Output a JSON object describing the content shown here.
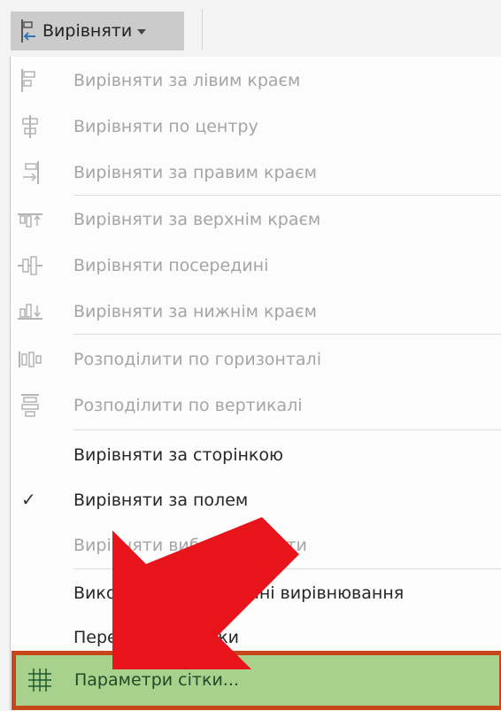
{
  "toolbar": {
    "align_button_label": "Вирівняти"
  },
  "menu": {
    "items": [
      {
        "label": "Вирівняти за лівим краєм",
        "icon": "align-left-icon",
        "enabled": false
      },
      {
        "label": "Вирівняти по центру",
        "icon": "align-center-icon",
        "enabled": false
      },
      {
        "label": "Вирівняти за правим краєм",
        "icon": "align-right-icon",
        "enabled": false
      },
      {
        "label": "Вирівняти за верхнім краєм",
        "icon": "align-top-icon",
        "enabled": false
      },
      {
        "label": "Вирівняти посередині",
        "icon": "align-middle-icon",
        "enabled": false
      },
      {
        "label": "Вирівняти за нижнім краєм",
        "icon": "align-bottom-icon",
        "enabled": false
      },
      {
        "label": "Розподілити по горизонталі",
        "icon": "distribute-horizontal-icon",
        "enabled": false
      },
      {
        "label": "Розподілити по вертикалі",
        "icon": "distribute-vertical-icon",
        "enabled": false
      },
      {
        "label": "Вирівняти за сторінкою",
        "icon": "",
        "enabled": true
      },
      {
        "label": "Вирівняти за полем",
        "icon": "check-icon",
        "enabled": true,
        "checked": true
      },
      {
        "label": "Вирівняти вибрані об'єкти",
        "icon": "",
        "enabled": false
      },
      {
        "label": "Використати напрямні вирівнювання",
        "icon": "",
        "enabled": true
      },
      {
        "label": "Переглянути сітки",
        "icon": "",
        "enabled": true
      },
      {
        "label": "Параметри сітки...",
        "icon": "grid-icon",
        "enabled": true,
        "highlighted": true
      }
    ]
  },
  "colors": {
    "highlight_fill": "#a9d18e",
    "highlight_border": "#c8471a",
    "arrow": "#e8141b",
    "disabled_text": "#a5a5a5"
  }
}
